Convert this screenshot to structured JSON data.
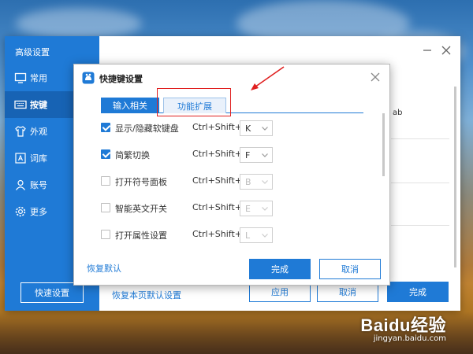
{
  "colors": {
    "accent": "#1f7ad6",
    "sidebar_active": "#1763b4",
    "annotation": "#e02020"
  },
  "adv_window": {
    "title": "高级设置",
    "sidebar": [
      {
        "label": "常用",
        "icon": "monitor-icon",
        "active": false
      },
      {
        "label": "按键",
        "icon": "keyboard-icon",
        "active": true
      },
      {
        "label": "外观",
        "icon": "tshirt-icon",
        "active": false
      },
      {
        "label": "词库",
        "icon": "dictionary-icon",
        "active": false
      },
      {
        "label": "账号",
        "icon": "user-icon",
        "active": false
      },
      {
        "label": "更多",
        "icon": "gear-icon",
        "active": false
      }
    ],
    "quick_setup": "快速设置",
    "partial_text": "ab",
    "restore_page_default": "恢复本页默认设置",
    "apply": "应用",
    "cancel": "取消",
    "done": "完成"
  },
  "dialog": {
    "title": "快捷键设置",
    "tabs": [
      {
        "label": "输入相关",
        "active": true
      },
      {
        "label": "功能扩展",
        "active": false
      }
    ],
    "rows": [
      {
        "label": "显示/隐藏软键盘",
        "checked": true,
        "combo": "Ctrl+Shift+",
        "key": "K"
      },
      {
        "label": "简繁切换",
        "checked": true,
        "combo": "Ctrl+Shift+",
        "key": "F"
      },
      {
        "label": "打开符号面板",
        "checked": false,
        "combo": "Ctrl+Shift+",
        "key": "B"
      },
      {
        "label": "智能英文开关",
        "checked": false,
        "combo": "Ctrl+Shift+",
        "key": "E"
      },
      {
        "label": "打开属性设置",
        "checked": false,
        "combo": "Ctrl+Shift+",
        "key": "L"
      }
    ],
    "restore_default": "恢复默认",
    "done": "完成",
    "cancel": "取消"
  },
  "watermark": {
    "brand": "Baidu经验",
    "url": "jingyan.baidu.com"
  }
}
